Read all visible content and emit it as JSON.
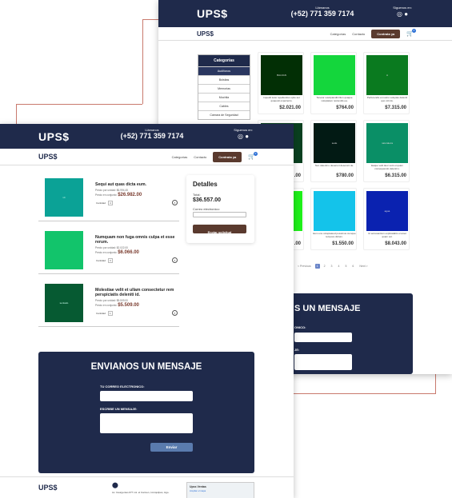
{
  "brand": {
    "logo": "UPS$",
    "logo_small": "UPS$"
  },
  "header": {
    "call_label": "Llámanos",
    "phone": "(+52) 771 359 7174",
    "follow_label": "Síguenos en:"
  },
  "nav": {
    "links": [
      "Categorías",
      "Contacto"
    ],
    "cta": "Contrata ya",
    "cart_count": "0"
  },
  "sidebar": {
    "title": "Categorías",
    "items": [
      {
        "label": "Audífonos",
        "active": true
      },
      {
        "label": "Bolsitas"
      },
      {
        "label": "Memorias"
      },
      {
        "label": "Mochila"
      },
      {
        "label": "Cables"
      },
      {
        "label": "Cámara de Seguridad"
      }
    ]
  },
  "products": [
    {
      "img_label": "BALKAN",
      "color": "#022f05",
      "desc": "Impedit iusto repellendus optio aut quaeosit experiento.",
      "price": "$2.021.00"
    },
    {
      "img_label": "",
      "color": "#14d63c",
      "desc": "Tenetur suscipianditi illum quaque voluptatem reiciendis ea.",
      "price": "$764.00"
    },
    {
      "img_label": "A",
      "color": "#0a7a1f",
      "desc": "Perferendis et nostro voluptas deleniti quo ncit du.",
      "price": "$7.315.00"
    },
    {
      "img_label": "",
      "color": "#0a4020",
      "desc": "",
      "price": ".00"
    },
    {
      "img_label": "sede",
      "color": "#021a14",
      "desc": "Non deleniti u deserunt deserunt de.",
      "price": "$780.00"
    },
    {
      "img_label": "naturaleza",
      "color": "#0a8f66",
      "desc": "Eaque velit deur sunt et quam consequendo deleniti s.",
      "price": "$6.315.00"
    },
    {
      "img_label": "",
      "color": "#1ff01a",
      "desc": "",
      "price": ".00"
    },
    {
      "img_label": "",
      "color": "#14c3ea",
      "desc": "Eum unu voluptateud possimus cumque tempore dictum.",
      "price": "$1.550.00"
    },
    {
      "img_label": "agua",
      "color": "#0a22b0",
      "desc": "Ut accusantium explicatabis el amet quam vel.",
      "price": "$8.043.00"
    }
  ],
  "pagination": {
    "prev": "< Previous",
    "pages": [
      "1",
      "2",
      "3",
      "4",
      "5",
      "6"
    ],
    "current": "1",
    "next": "Next >"
  },
  "cart": {
    "items": [
      {
        "img_label": "v4",
        "color": "#0ba296",
        "name": "Sequi aut quas dicta eum.",
        "unit_label": "Precio por unidad: $6.994.45",
        "total_label": "Precio en conjunto:",
        "total": "$26.982.00",
        "qty_label": "Cantidad",
        "qty": "4"
      },
      {
        "img_label": "",
        "color": "#12c46b",
        "name": "Numquam non fuga omnis culpa et esse rerum.",
        "unit_label": "Precio por unidad: $2.022.00",
        "total_label": "Precio en conjunto:",
        "total": "$6.066.00",
        "qty_label": "Cantidad",
        "qty": "3"
      },
      {
        "img_label": "sentado",
        "color": "#065a32",
        "name": "Molestiae velit et ullam consectetur rem perspiciatis deleniti id.",
        "unit_label": "Precio por unidad: $5.509.00",
        "total_label": "Precio en conjunto:",
        "total": "$5.509.00",
        "qty_label": "Cantidad",
        "qty": "1"
      }
    ]
  },
  "details": {
    "title": "Detalles",
    "total_label": "Total:",
    "total": "$36.557.00",
    "email_label": "Correo electronico:",
    "submit": "Enviar solicitud"
  },
  "message_form": {
    "title": "ENVIANOS UN MENSAJE",
    "title_partial": "S UN MENSAJE",
    "email_label": "TU CORREO ELECTRONICO:",
    "email_label_partial": "ONICO:",
    "message_label": "ESCRIBE UN MENSAJE:",
    "message_label_partial": "JE:",
    "send": "Enviar"
  },
  "footer": {
    "logo": "UPS$",
    "address": "Av. Insurgentes #77 col. el Carmen, Ixmiquilpan, Hgo.",
    "map_title": "Upss Ventas",
    "map_link": "Ampliar el mapa"
  },
  "colors": {
    "navy": "#1f2a4b",
    "brown": "#5a3a2e",
    "accent": "#2b6fd6"
  }
}
